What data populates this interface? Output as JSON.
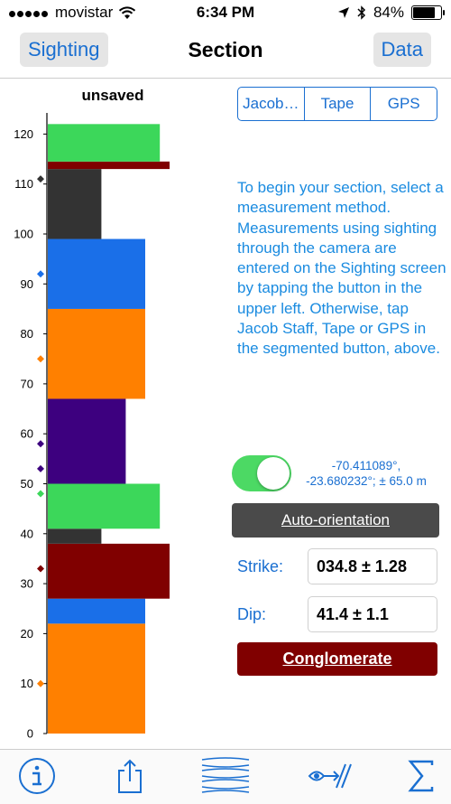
{
  "status": {
    "carrier": "movistar",
    "time": "6:34 PM",
    "battery": "84%",
    "battery_level": 0.84
  },
  "nav": {
    "left_label": "Sighting",
    "title": "Section",
    "right_label": "Data"
  },
  "chart_data": {
    "type": "stratigraphic-column",
    "title": "unsaved",
    "ylim": [
      0,
      122
    ],
    "yticks": [
      0,
      10,
      20,
      30,
      40,
      50,
      60,
      70,
      80,
      90,
      100,
      110,
      120
    ],
    "layers": [
      {
        "bottom": 0,
        "top": 22,
        "width": 2.0,
        "color": "#ff8000"
      },
      {
        "bottom": 22,
        "top": 27,
        "width": 2.0,
        "color": "#1a6fe8"
      },
      {
        "bottom": 27,
        "top": 38,
        "width": 2.5,
        "color": "#800000"
      },
      {
        "bottom": 38,
        "top": 41,
        "width": 1.1,
        "color": "#333333"
      },
      {
        "bottom": 41,
        "top": 50,
        "width": 2.3,
        "color": "#3cd75a"
      },
      {
        "bottom": 50,
        "top": 67,
        "width": 1.6,
        "color": "#3d007f"
      },
      {
        "bottom": 67,
        "top": 85,
        "width": 2.0,
        "color": "#ff8000"
      },
      {
        "bottom": 85,
        "top": 99,
        "width": 2.0,
        "color": "#1a6fe8"
      },
      {
        "bottom": 99,
        "top": 113,
        "width": 1.1,
        "color": "#333333"
      },
      {
        "bottom": 113,
        "top": 114.5,
        "width": 2.5,
        "color": "#800000"
      },
      {
        "bottom": 114.5,
        "top": 122,
        "width": 2.3,
        "color": "#3cd75a"
      }
    ],
    "markers": [
      {
        "y": 10,
        "color": "#ff8000"
      },
      {
        "y": 33,
        "color": "#800000"
      },
      {
        "y": 48,
        "color": "#3cd75a"
      },
      {
        "y": 53,
        "color": "#3d007f"
      },
      {
        "y": 58,
        "color": "#3d007f"
      },
      {
        "y": 75,
        "color": "#ff8000"
      },
      {
        "y": 92,
        "color": "#1a6fe8"
      },
      {
        "y": 111,
        "color": "#333333"
      }
    ]
  },
  "segments": [
    "Jacob…",
    "Tape",
    "GPS"
  ],
  "info_text": "To begin your section, select a measurement method. Measurements using sighting through the camera are entered on the Sighting screen by tapping the button in the upper left. Otherwise, tap Jacob Staff, Tape or GPS in the segmented button, above.",
  "location": {
    "line1": "-70.411089°,",
    "line2": "-23.680232°;  ± 65.0 m",
    "toggle_on": true
  },
  "auto_label": "Auto-orientation",
  "strike": {
    "label": "Strike:",
    "value": "034.8 ± 1.28"
  },
  "dip": {
    "label": "Dip:",
    "value": "41.4 ± 1.1"
  },
  "lithology": {
    "label": "Conglomerate",
    "color": "#800000"
  },
  "tabs": [
    "info-icon",
    "share-icon",
    "section-icon",
    "sighting-icon",
    "sum-icon"
  ],
  "accent": "#1a6fd1"
}
